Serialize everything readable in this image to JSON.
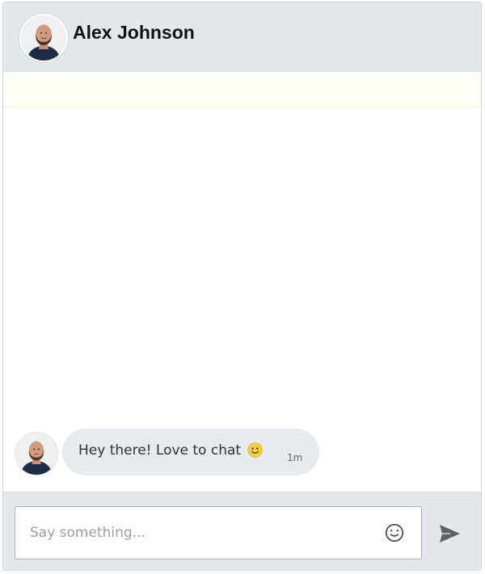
{
  "contact": {
    "name": "Alex Johnson",
    "avatar_icon": "profile-photo"
  },
  "messages": [
    {
      "text": "Hey there! Love to chat",
      "emoji_icon": "smiling-face-emoji",
      "time": "1m"
    }
  ],
  "composer": {
    "placeholder": "Say something...",
    "value": "",
    "emoji_icon": "smiley-face-icon",
    "send_icon": "send-arrow-icon"
  },
  "colors": {
    "header_bg": "#e4e8ec",
    "bubble_bg": "#e7eaee",
    "notice_bg": "#fffff7",
    "accent_icon": "#5f6368"
  }
}
